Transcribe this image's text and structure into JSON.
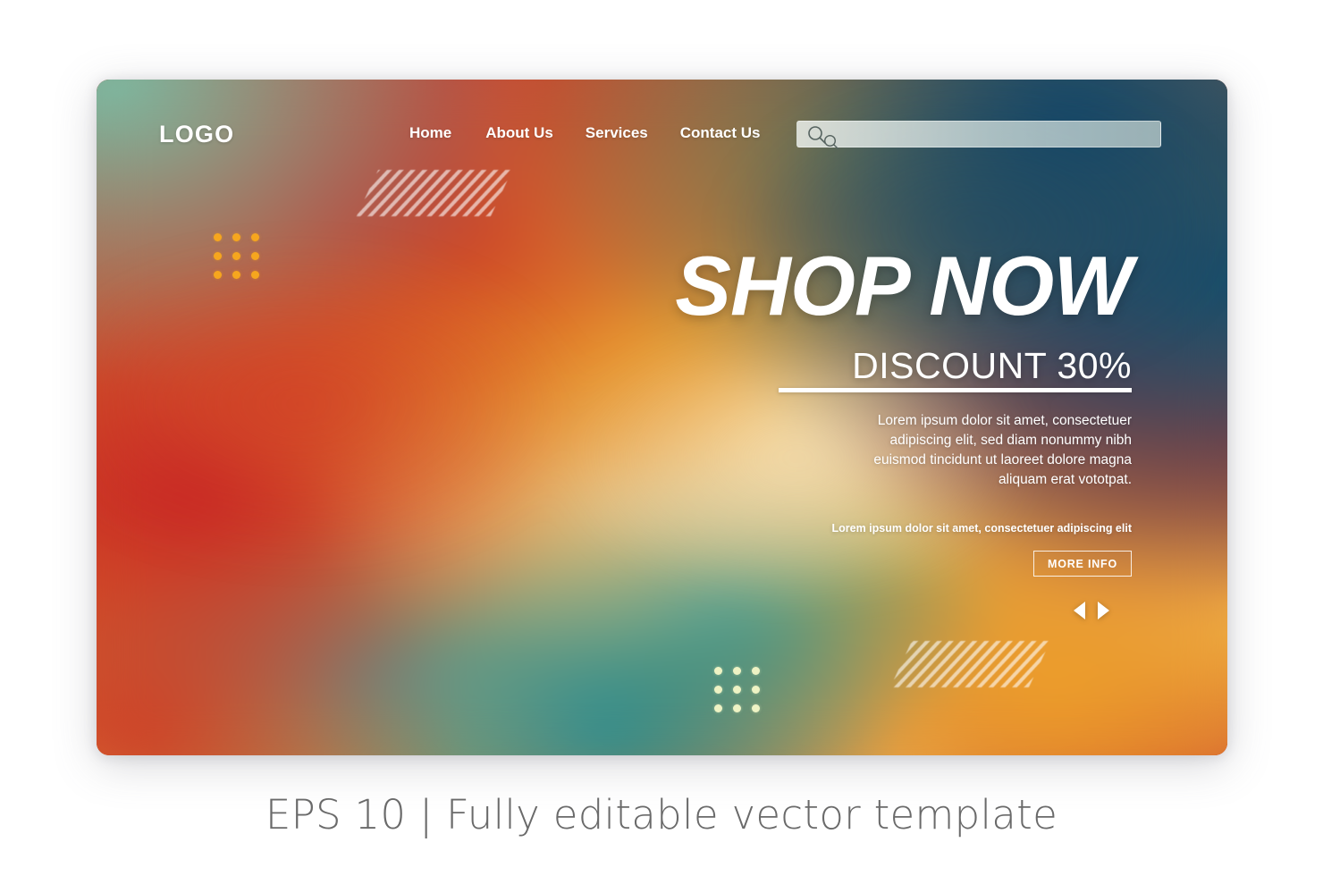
{
  "caption": "EPS 10 | Fully editable vector template",
  "header": {
    "logo": "LOGO",
    "nav": [
      {
        "label": "Home"
      },
      {
        "label": "About Us"
      },
      {
        "label": "Services"
      },
      {
        "label": "Contact Us"
      }
    ],
    "search": {
      "value": "",
      "placeholder": "",
      "icon": "search-icon",
      "ghost_icon": "search-icon"
    }
  },
  "hero": {
    "headline": "SHOP NOW",
    "subheadline": "DISCOUNT 30%",
    "body": "Lorem ipsum dolor sit amet, consectetuer adipiscing elit, sed diam nonummy nibh euismod tincidunt ut laoreet dolore magna aliquam erat vototpat.",
    "tagline": "Lorem ipsum dolor sit amet, consectetuer adipiscing elit",
    "cta_label": "MORE INFO",
    "prev_icon": "triangle-left-icon",
    "next_icon": "triangle-right-icon"
  },
  "decor": {
    "dot_grid_left_color": "#f6a61e",
    "dot_grid_bottom_color": "#eef3c4",
    "stripe_color": "#ffffff"
  },
  "colors": {
    "page_background": "#ffffff",
    "text_on_hero": "#ffffff",
    "caption_color": "#6a6a6a",
    "gradient_teal": "#78bea5",
    "gradient_deep_blue": "#124668",
    "gradient_red": "#c62a26",
    "gradient_orange": "#e78d26",
    "gradient_gold": "#eaaa30",
    "gradient_cream": "#f6e2b4",
    "gradient_cyan": "#228c94"
  }
}
